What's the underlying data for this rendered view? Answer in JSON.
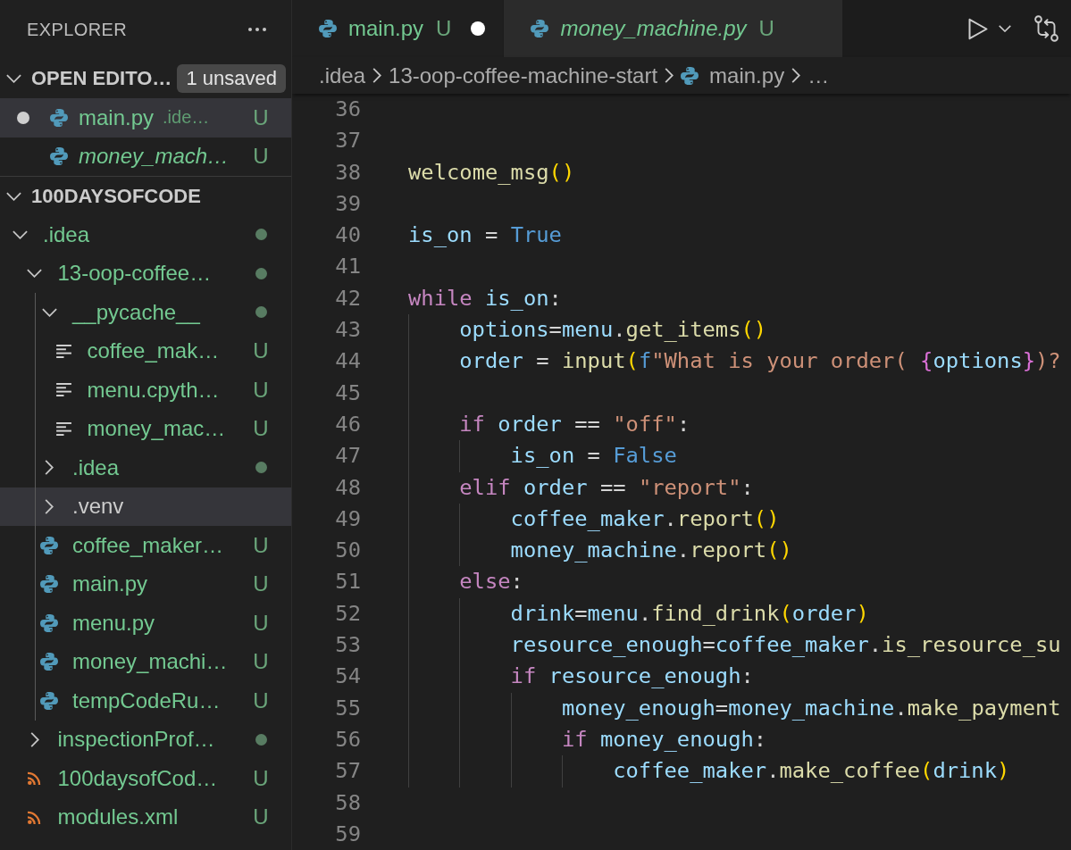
{
  "sidebar": {
    "title": "EXPLORER",
    "open_editors": {
      "title": "OPEN EDITO…",
      "expanded": true,
      "badge": "1 unsaved",
      "items": [
        {
          "name": "main.py",
          "description": ".ide…",
          "status": "U",
          "kind": "python",
          "dirty": true,
          "preview": false,
          "selected": true
        },
        {
          "name": "money_mach…",
          "status": "U",
          "kind": "python",
          "dirty": false,
          "preview": true,
          "selected": false
        }
      ]
    },
    "workspace": {
      "title": "100DAYSOFCODE",
      "expanded": true,
      "tree": [
        {
          "name": ".idea",
          "kind": "folder",
          "expanded": true,
          "dot": true,
          "selected": false,
          "children": [
            {
              "name": "13-oop-coffee…",
              "kind": "folder",
              "expanded": true,
              "dot": true,
              "selected": false,
              "children": [
                {
                  "name": "__pycache__",
                  "kind": "folder",
                  "expanded": true,
                  "dot": true,
                  "selected": false,
                  "children": [
                    {
                      "name": "coffee_mak…",
                      "kind": "text",
                      "status": "U",
                      "selected": false
                    },
                    {
                      "name": "menu.cpyth…",
                      "kind": "text",
                      "status": "U",
                      "selected": false
                    },
                    {
                      "name": "money_mac…",
                      "kind": "text",
                      "status": "U",
                      "selected": false
                    }
                  ]
                },
                {
                  "name": ".idea",
                  "kind": "folder",
                  "expanded": false,
                  "dot": true,
                  "selected": false
                },
                {
                  "name": ".venv",
                  "kind": "folder",
                  "expanded": false,
                  "dot": false,
                  "selected": true
                },
                {
                  "name": "coffee_maker…",
                  "kind": "python",
                  "status": "U",
                  "selected": false
                },
                {
                  "name": "main.py",
                  "kind": "python",
                  "status": "U",
                  "selected": false
                },
                {
                  "name": "menu.py",
                  "kind": "python",
                  "status": "U",
                  "selected": false
                },
                {
                  "name": "money_machi…",
                  "kind": "python",
                  "status": "U",
                  "selected": false
                },
                {
                  "name": "tempCodeRu…",
                  "kind": "python",
                  "status": "U",
                  "selected": false
                }
              ]
            },
            {
              "name": "inspectionProf…",
              "kind": "folder",
              "expanded": false,
              "dot": true,
              "selected": false
            },
            {
              "name": "100daysofCod…",
              "kind": "xml",
              "status": "U",
              "selected": false
            },
            {
              "name": "modules.xml",
              "kind": "xml",
              "status": "U",
              "selected": false
            }
          ]
        }
      ]
    }
  },
  "editor": {
    "tabs": [
      {
        "label": "main.py",
        "status": "U",
        "kind": "python",
        "selected": true,
        "dirty": true,
        "preview": false
      },
      {
        "label": "money_machine.py",
        "status": "U",
        "kind": "python",
        "selected": false,
        "dirty": false,
        "preview": true
      }
    ],
    "breadcrumbs": [
      {
        "label": ".idea",
        "kind": "folder"
      },
      {
        "label": "13-oop-coffee-machine-start",
        "kind": "folder"
      },
      {
        "label": "main.py",
        "kind": "python"
      },
      {
        "label": "…",
        "kind": "more"
      }
    ],
    "lines": [
      {
        "number": "36"
      },
      {
        "number": "37"
      },
      {
        "number": "38",
        "tokens": [
          {
            "text": "welcome_msg",
            "kind": "function"
          },
          {
            "text": "()",
            "kind": "bracket"
          }
        ]
      },
      {
        "number": "39"
      },
      {
        "number": "40",
        "tokens": [
          {
            "text": "is_on",
            "kind": "variable"
          },
          {
            "text": " = ",
            "kind": "operator"
          },
          {
            "text": "True",
            "kind": "constant"
          }
        ]
      },
      {
        "number": "41"
      },
      {
        "number": "42",
        "tokens": [
          {
            "text": "while ",
            "kind": "keyword"
          },
          {
            "text": "is_on",
            "kind": "variable"
          },
          {
            "text": ":",
            "kind": "operator"
          }
        ],
        "children": [
          {
            "number": "43",
            "tokens": [
              {
                "text": "options",
                "kind": "variable"
              },
              {
                "text": "=",
                "kind": "operator"
              },
              {
                "text": "menu",
                "kind": "variable"
              },
              {
                "text": ".",
                "kind": "operator"
              },
              {
                "text": "get_items",
                "kind": "function"
              },
              {
                "text": "()",
                "kind": "bracket"
              }
            ]
          },
          {
            "number": "44",
            "tokens": [
              {
                "text": "order",
                "kind": "variable"
              },
              {
                "text": " = ",
                "kind": "operator"
              },
              {
                "text": "input",
                "kind": "function"
              },
              {
                "text": "(",
                "kind": "bracket"
              },
              {
                "text": "f",
                "kind": "storage"
              },
              {
                "text": "\"What is your order( ",
                "kind": "string"
              },
              {
                "text": "{",
                "kind": "brace"
              },
              {
                "text": "options",
                "kind": "variable"
              },
              {
                "text": "}",
                "kind": "brace"
              },
              {
                "text": ")?",
                "kind": "string"
              }
            ]
          },
          {
            "number": "45"
          },
          {
            "number": "46",
            "tokens": [
              {
                "text": "if ",
                "kind": "keyword"
              },
              {
                "text": "order",
                "kind": "variable"
              },
              {
                "text": " == ",
                "kind": "operator"
              },
              {
                "text": "\"off\"",
                "kind": "string"
              },
              {
                "text": ":",
                "kind": "operator"
              }
            ],
            "children": [
              {
                "number": "47",
                "tokens": [
                  {
                    "text": "is_on",
                    "kind": "variable"
                  },
                  {
                    "text": " = ",
                    "kind": "operator"
                  },
                  {
                    "text": "False",
                    "kind": "constant"
                  }
                ]
              }
            ]
          },
          {
            "number": "48",
            "tokens": [
              {
                "text": "elif ",
                "kind": "keyword"
              },
              {
                "text": "order",
                "kind": "variable"
              },
              {
                "text": " == ",
                "kind": "operator"
              },
              {
                "text": "\"report\"",
                "kind": "string"
              },
              {
                "text": ":",
                "kind": "operator"
              }
            ],
            "children": [
              {
                "number": "49",
                "tokens": [
                  {
                    "text": "coffee_maker",
                    "kind": "variable"
                  },
                  {
                    "text": ".",
                    "kind": "operator"
                  },
                  {
                    "text": "report",
                    "kind": "function"
                  },
                  {
                    "text": "()",
                    "kind": "bracket"
                  }
                ]
              },
              {
                "number": "50",
                "tokens": [
                  {
                    "text": "money_machine",
                    "kind": "variable"
                  },
                  {
                    "text": ".",
                    "kind": "operator"
                  },
                  {
                    "text": "report",
                    "kind": "function"
                  },
                  {
                    "text": "()",
                    "kind": "bracket"
                  }
                ]
              }
            ]
          },
          {
            "number": "51",
            "tokens": [
              {
                "text": "else",
                "kind": "keyword"
              },
              {
                "text": ":",
                "kind": "operator"
              }
            ],
            "children": [
              {
                "number": "52",
                "tokens": [
                  {
                    "text": "drink",
                    "kind": "variable"
                  },
                  {
                    "text": "=",
                    "kind": "operator"
                  },
                  {
                    "text": "menu",
                    "kind": "variable"
                  },
                  {
                    "text": ".",
                    "kind": "operator"
                  },
                  {
                    "text": "find_drink",
                    "kind": "function"
                  },
                  {
                    "text": "(",
                    "kind": "bracket"
                  },
                  {
                    "text": "order",
                    "kind": "variable"
                  },
                  {
                    "text": ")",
                    "kind": "bracket"
                  }
                ]
              },
              {
                "number": "53",
                "tokens": [
                  {
                    "text": "resource_enough",
                    "kind": "variable"
                  },
                  {
                    "text": "=",
                    "kind": "operator"
                  },
                  {
                    "text": "coffee_maker",
                    "kind": "variable"
                  },
                  {
                    "text": ".",
                    "kind": "operator"
                  },
                  {
                    "text": "is_resource_su",
                    "kind": "function"
                  }
                ]
              },
              {
                "number": "54",
                "tokens": [
                  {
                    "text": "if ",
                    "kind": "keyword"
                  },
                  {
                    "text": "resource_enough",
                    "kind": "variable"
                  },
                  {
                    "text": ":",
                    "kind": "operator"
                  }
                ],
                "children": [
                  {
                    "number": "55",
                    "tokens": [
                      {
                        "text": "money_enough",
                        "kind": "variable"
                      },
                      {
                        "text": "=",
                        "kind": "operator"
                      },
                      {
                        "text": "money_machine",
                        "kind": "variable"
                      },
                      {
                        "text": ".",
                        "kind": "operator"
                      },
                      {
                        "text": "make_payment",
                        "kind": "function"
                      }
                    ]
                  },
                  {
                    "number": "56",
                    "tokens": [
                      {
                        "text": "if ",
                        "kind": "keyword"
                      },
                      {
                        "text": "money_enough",
                        "kind": "variable"
                      },
                      {
                        "text": ":",
                        "kind": "operator"
                      }
                    ],
                    "children": [
                      {
                        "number": "57",
                        "tokens": [
                          {
                            "text": "coffee_maker",
                            "kind": "variable"
                          },
                          {
                            "text": ".",
                            "kind": "operator"
                          },
                          {
                            "text": "make_coffee",
                            "kind": "function"
                          },
                          {
                            "text": "(",
                            "kind": "bracket"
                          },
                          {
                            "text": "drink",
                            "kind": "variable"
                          },
                          {
                            "text": ")",
                            "kind": "bracket"
                          }
                        ]
                      }
                    ]
                  }
                ]
              }
            ]
          }
        ]
      },
      {
        "number": "58"
      },
      {
        "number": "59"
      }
    ]
  }
}
